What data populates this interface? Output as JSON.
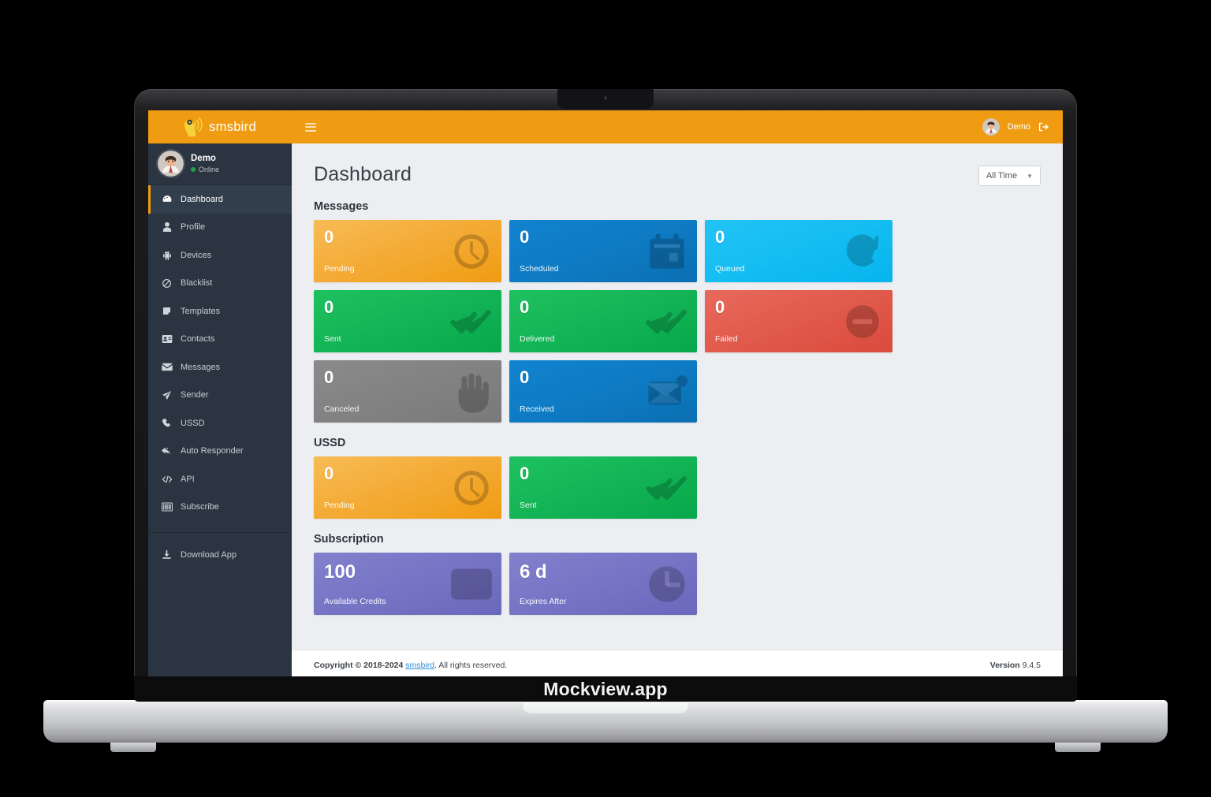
{
  "mockup": {
    "brand_label": "Mockview.app"
  },
  "app": {
    "logo_text": "smsbird",
    "logo_icon": "bird-sound-icon"
  },
  "topbar": {
    "menu_icon": "hamburger-icon",
    "user_label": "Demo",
    "logout_icon": "logout-icon",
    "avatar_icon": "avatar"
  },
  "sidebar": {
    "user": {
      "name": "Demo",
      "status": "Online",
      "status_color": "#25a244"
    },
    "items": [
      {
        "label": "Dashboard",
        "icon": "dashboard-icon",
        "active": true
      },
      {
        "label": "Profile",
        "icon": "user-icon",
        "active": false
      },
      {
        "label": "Devices",
        "icon": "android-icon",
        "active": false
      },
      {
        "label": "Blacklist",
        "icon": "ban-icon",
        "active": false
      },
      {
        "label": "Templates",
        "icon": "note-icon",
        "active": false
      },
      {
        "label": "Contacts",
        "icon": "address-card-icon",
        "active": false
      },
      {
        "label": "Messages",
        "icon": "envelope-icon",
        "active": false
      },
      {
        "label": "Sender",
        "icon": "paper-plane-icon",
        "active": false
      },
      {
        "label": "USSD",
        "icon": "phone-icon",
        "active": false
      },
      {
        "label": "Auto Responder",
        "icon": "reply-all-icon",
        "active": false
      },
      {
        "label": "API",
        "icon": "code-icon",
        "active": false
      },
      {
        "label": "Subscribe",
        "icon": "subscribe-icon",
        "active": false
      }
    ],
    "footer_items": [
      {
        "label": "Download App",
        "icon": "download-icon"
      }
    ]
  },
  "main": {
    "page_title": "Dashboard",
    "range_filter": {
      "value": "All Time",
      "chevron_icon": "chevron-down-icon"
    },
    "sections": [
      {
        "title": "Messages",
        "cards": [
          {
            "value": "0",
            "label": "Pending",
            "color": "#ef9c12",
            "theme": "c-orange",
            "icon": "stopwatch-icon"
          },
          {
            "value": "0",
            "label": "Scheduled",
            "color": "#0b6fb2",
            "theme": "c-blue",
            "icon": "calendar-icon"
          },
          {
            "value": "0",
            "label": "Queued",
            "color": "#06b5ed",
            "theme": "c-cyan",
            "icon": "sync-icon"
          },
          {
            "value": "0",
            "label": "Sent",
            "color": "#07a84b",
            "theme": "c-green",
            "icon": "double-check-icon"
          },
          {
            "value": "0",
            "label": "Delivered",
            "color": "#07a84b",
            "theme": "c-green",
            "icon": "double-check-icon"
          },
          {
            "value": "0",
            "label": "Failed",
            "color": "#da4b3c",
            "theme": "c-red",
            "icon": "minus-circle-icon"
          },
          {
            "value": "0",
            "label": "Canceled",
            "color": "#797979",
            "theme": "c-gray",
            "icon": "hand-icon"
          },
          {
            "value": "0",
            "label": "Received",
            "color": "#0b6fb2",
            "theme": "c-blue",
            "icon": "envelope-open-icon"
          }
        ]
      },
      {
        "title": "USSD",
        "cards": [
          {
            "value": "0",
            "label": "Pending",
            "color": "#ef9c12",
            "theme": "c-orange",
            "icon": "stopwatch-icon"
          },
          {
            "value": "0",
            "label": "Sent",
            "color": "#07a84b",
            "theme": "c-green",
            "icon": "double-check-icon"
          }
        ]
      },
      {
        "title": "Subscription",
        "cards": [
          {
            "value": "100",
            "label": "Available Credits",
            "color": "#6a68bb",
            "theme": "c-purple",
            "icon": "credit-card-icon"
          },
          {
            "value": "6 d",
            "label": "Expires After",
            "color": "#6a68bb",
            "theme": "c-purple",
            "icon": "clock-icon"
          }
        ]
      }
    ]
  },
  "footer": {
    "copyright_prefix": "Copyright © 2018-2024 ",
    "copyright_link": "smsbird",
    "copyright_suffix": ". All rights reserved.",
    "version_label": "Version",
    "version_value": "9.4.5"
  }
}
